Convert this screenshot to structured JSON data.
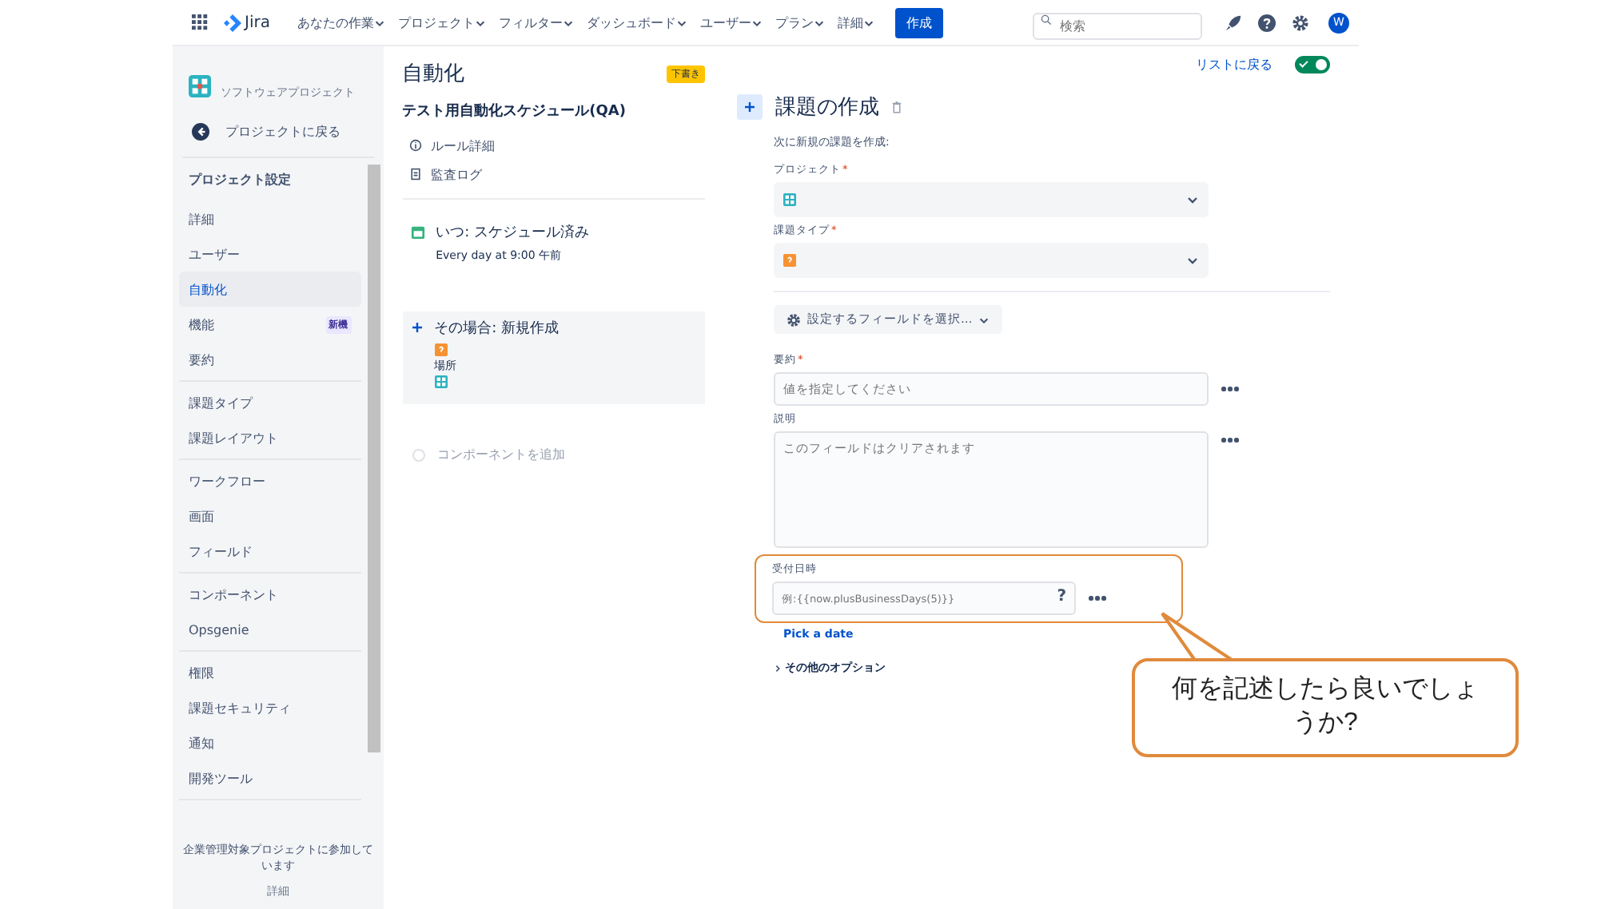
{
  "nav": {
    "product": "Jira",
    "items": [
      {
        "label": "あなたの作業"
      },
      {
        "label": "プロジェクト"
      },
      {
        "label": "フィルター"
      },
      {
        "label": "ダッシュボード"
      },
      {
        "label": "ユーザー"
      },
      {
        "label": "プラン"
      },
      {
        "label": "詳細"
      }
    ],
    "create": "作成",
    "search_placeholder": "検索",
    "avatar": "W"
  },
  "sidebar": {
    "project_type": "ソフトウェアプロジェクト",
    "back": "プロジェクトに戻る",
    "section_title": "プロジェクト設定",
    "groups": [
      [
        {
          "label": "詳細",
          "selected": false
        },
        {
          "label": "ユーザー",
          "selected": false
        },
        {
          "label": "自動化",
          "selected": true
        },
        {
          "label": "機能",
          "selected": false,
          "badge": "新機"
        },
        {
          "label": "要約",
          "selected": false
        }
      ],
      [
        {
          "label": "課題タイプ",
          "selected": false
        },
        {
          "label": "課題レイアウト",
          "selected": false
        }
      ],
      [
        {
          "label": "ワークフロー",
          "selected": false
        },
        {
          "label": "画面",
          "selected": false
        },
        {
          "label": "フィールド",
          "selected": false
        }
      ],
      [
        {
          "label": "コンポーネント",
          "selected": false
        },
        {
          "label": "Opsgenie",
          "selected": false
        }
      ],
      [
        {
          "label": "権限",
          "selected": false
        },
        {
          "label": "課題セキュリティ",
          "selected": false
        },
        {
          "label": "通知",
          "selected": false
        },
        {
          "label": "開発ツール",
          "selected": false
        }
      ]
    ],
    "footer": "企業管理対象プロジェクトに参加しています",
    "footer_link": "詳細"
  },
  "rule": {
    "title": "自動化",
    "status": "下書き",
    "name": "テスト用自動化スケジュール(QA)",
    "links": [
      {
        "kind": "info",
        "label": "ルール詳細"
      },
      {
        "kind": "log",
        "label": "監査ログ"
      }
    ],
    "trigger": {
      "title": "いつ: スケジュール済み",
      "detail": "Every day at 9:00 午前"
    },
    "action": {
      "title": "その場合: 新規作成",
      "location": "場所"
    },
    "add": "コンポーネントを追加"
  },
  "panel": {
    "back": "リストに戻る",
    "enabled": true,
    "title": "課題の作成",
    "subtitle": "次に新規の課題を作成:",
    "selects": [
      {
        "label": "プロジェクト",
        "required_mark": "*",
        "kind": "project"
      },
      {
        "label": "課題タイプ",
        "required_mark": "*",
        "kind": "issuetype"
      }
    ],
    "field_picker": "設定するフィールドを選択...",
    "summary": {
      "label": "要約",
      "required_mark": "*",
      "placeholder": "値を指定してください"
    },
    "description": {
      "label": "説明",
      "placeholder": "このフィールドはクリアされます"
    },
    "due": {
      "label": "受付日時",
      "placeholder": "例:{{now.plusBusinessDays(5)}}",
      "help": "?",
      "link": "Pick a date"
    },
    "more": "その他のオプション"
  },
  "callout": {
    "text": "何を記述したら良いでしょうか?"
  }
}
